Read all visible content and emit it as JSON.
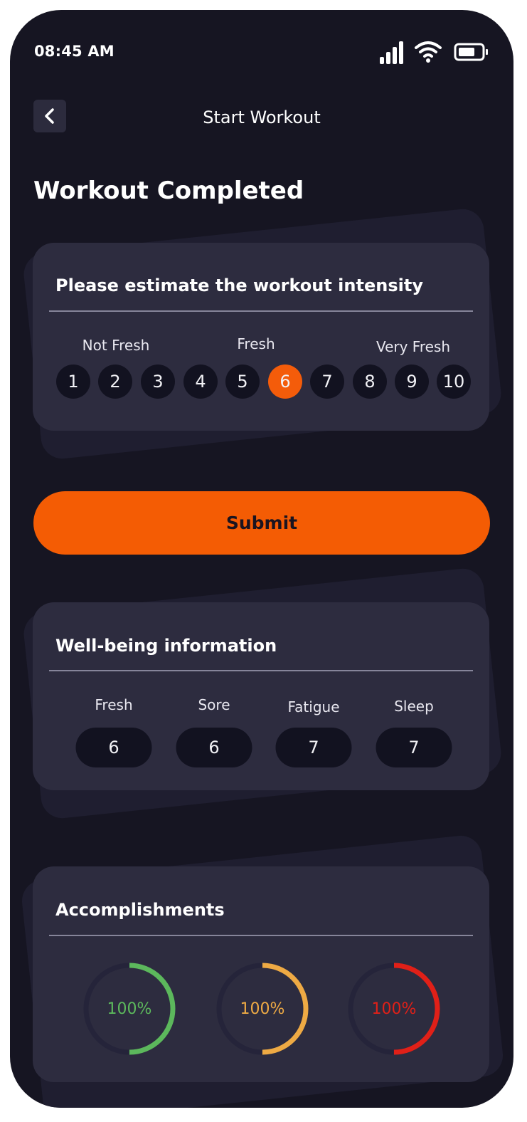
{
  "status_bar": {
    "time": "08:45 AM"
  },
  "header": {
    "title": "Start Workout"
  },
  "page": {
    "heading": "Workout Completed"
  },
  "intensity": {
    "title": "Please estimate the workout intensity",
    "labels": [
      "Not Fresh",
      "Fresh",
      "Very Fresh"
    ],
    "numbers": [
      "1",
      "2",
      "3",
      "4",
      "5",
      "6",
      "7",
      "8",
      "9",
      "10"
    ],
    "selected": "6"
  },
  "submit": {
    "label": "Submit"
  },
  "wellbeing": {
    "title": "Well-being information",
    "items": [
      {
        "label": "Fresh",
        "value": "6"
      },
      {
        "label": "Sore",
        "value": "6"
      },
      {
        "label": "Fatigue",
        "value": "7"
      },
      {
        "label": "Sleep",
        "value": "7"
      }
    ]
  },
  "accomplishments": {
    "title": "Accomplishments",
    "rings": [
      {
        "label": "100%",
        "color": "#5cb85c",
        "progress": 0.5
      },
      {
        "label": "100%",
        "color": "#eeaa44",
        "progress": 0.5
      },
      {
        "label": "100%",
        "color": "#e02018",
        "progress": 0.5
      }
    ]
  },
  "colors": {
    "accent": "#f45c04",
    "background": "#161522",
    "card": "#2d2c3f"
  }
}
